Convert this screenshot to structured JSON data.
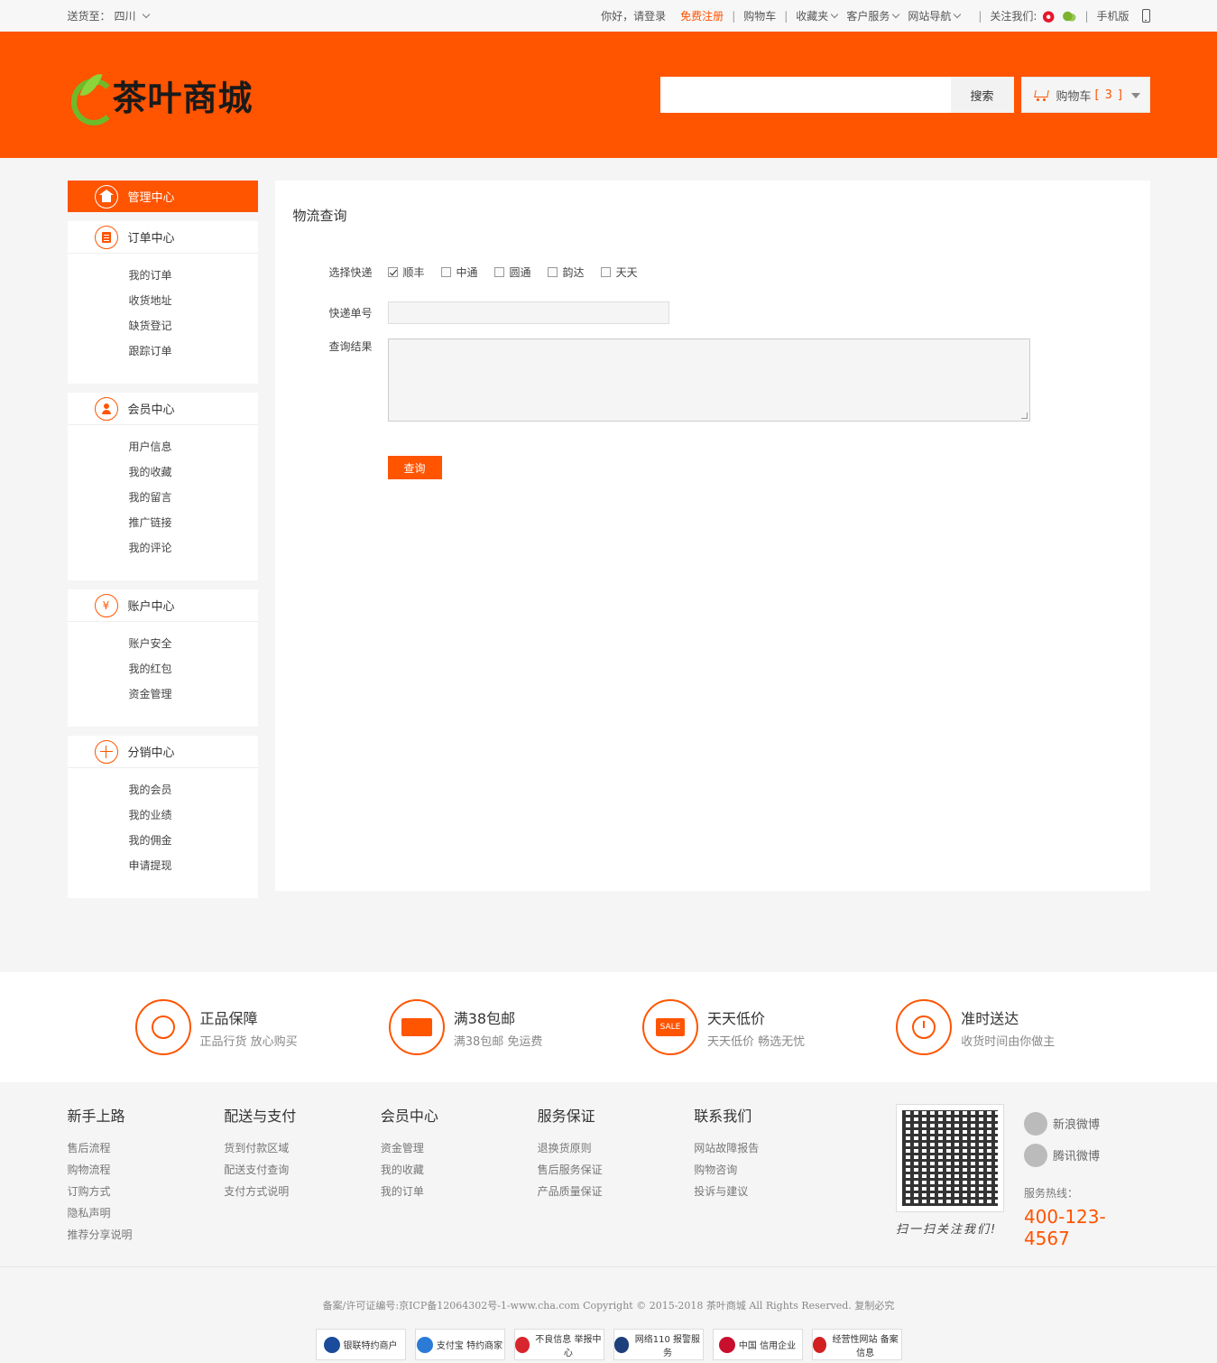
{
  "topbar": {
    "location_label": "送货至：",
    "location_value": "四川",
    "greeting": "你好，请登录",
    "register": "免费注册",
    "cart": "购物车",
    "favorites": "收藏夹",
    "service": "客户服务",
    "site_nav": "网站导航",
    "follow": "关注我们:",
    "mobile": "手机版",
    "separator": "|"
  },
  "header": {
    "logo_text": "茶叶商城",
    "search_placeholder": "",
    "search_button": "搜索",
    "cart_label": "购物车",
    "cart_open": "[",
    "cart_count": "3",
    "cart_close": "]"
  },
  "sidebar": {
    "home": "管理中心",
    "groups": [
      {
        "title": "订单中心",
        "items": [
          "我的订单",
          "收货地址",
          "缺货登记",
          "跟踪订单"
        ]
      },
      {
        "title": "会员中心",
        "items": [
          "用户信息",
          "我的收藏",
          "我的留言",
          "推广链接",
          "我的评论"
        ]
      },
      {
        "title": "账户中心",
        "icon_char": "¥",
        "items": [
          "账户安全",
          "我的红包",
          "资金管理"
        ]
      },
      {
        "title": "分销中心",
        "items": [
          "我的会员",
          "我的业绩",
          "我的佣金",
          "申请提现"
        ]
      }
    ]
  },
  "content": {
    "title": "物流查询",
    "courier_label": "选择快递",
    "couriers": [
      {
        "name": "顺丰",
        "checked": true
      },
      {
        "name": "中通",
        "checked": false
      },
      {
        "name": "圆通",
        "checked": false
      },
      {
        "name": "韵达",
        "checked": false
      },
      {
        "name": "天天",
        "checked": false
      }
    ],
    "tracking_label": "快递单号",
    "tracking_value": "",
    "result_label": "查询结果",
    "result_value": "",
    "query_button": "查询"
  },
  "features": [
    {
      "title": "正品保障",
      "sub": "正品行货 放心购买",
      "icon": "badge-icon"
    },
    {
      "title": "满38包邮",
      "sub": "满38包邮 免运费",
      "icon": "truck-icon"
    },
    {
      "title": "天天低价",
      "sub": "天天低价 畅选无忧",
      "icon": "sale-icon",
      "icon_text": "SALE"
    },
    {
      "title": "准时送达",
      "sub": "收货时间由你做主",
      "icon": "clock-icon"
    }
  ],
  "footer": {
    "columns": [
      {
        "title": "新手上路",
        "links": [
          "售后流程",
          "购物流程",
          "订购方式",
          "隐私声明",
          "推荐分享说明"
        ]
      },
      {
        "title": "配送与支付",
        "links": [
          "货到付款区域",
          "配送支付查询",
          "支付方式说明"
        ]
      },
      {
        "title": "会员中心",
        "links": [
          "资金管理",
          "我的收藏",
          "我的订单"
        ]
      },
      {
        "title": "服务保证",
        "links": [
          "退换货原则",
          "售后服务保证",
          "产品质量保证"
        ]
      },
      {
        "title": "联系我们",
        "links": [
          "网站故障报告",
          "购物咨询",
          "投诉与建议"
        ]
      }
    ],
    "qr_caption": "扫一扫关注我们!",
    "weibo": "新浪微博",
    "tencent_weibo": "腾讯微博",
    "hotline_label": "服务热线：",
    "hotline": "400-123-4567"
  },
  "bottom": {
    "copyright": "备案/许可证编号:京ICP备12064302号-1-www.cha.com Copyright © 2015-2018 茶叶商城 All Rights Reserved. 复制必究",
    "certs": [
      {
        "text": "银联特约商户",
        "color": "#1a4b9c"
      },
      {
        "text": "支付宝 特约商家",
        "color": "#2b7bd6"
      },
      {
        "text": "不良信息 举报中心",
        "color": "#d8262e"
      },
      {
        "text": "网络110 报警服务",
        "color": "#1d3f7a"
      },
      {
        "text": "中国 信用企业",
        "color": "#c8102e"
      },
      {
        "text": "经营性网站 备案信息",
        "color": "#d22020"
      }
    ]
  },
  "colors": {
    "accent": "#ff5400"
  }
}
